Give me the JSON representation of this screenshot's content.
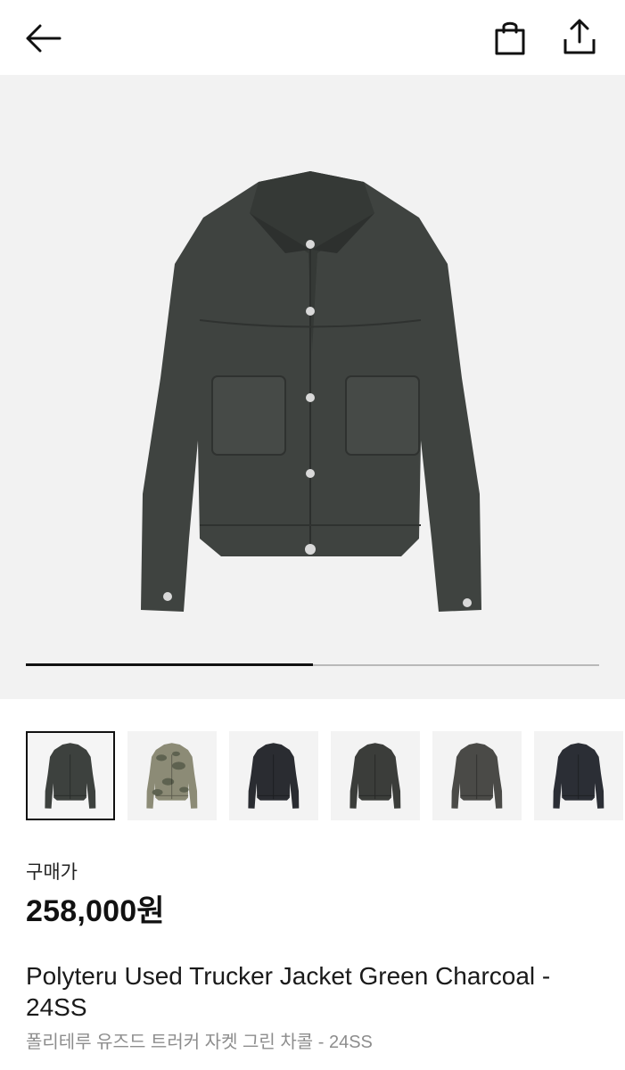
{
  "header": {
    "back_icon": "arrow-left-icon",
    "bag_icon": "shopping-bag-icon",
    "share_icon": "share-upload-icon"
  },
  "gallery": {
    "progress_fraction": 0.5,
    "main_jacket_color": "#3f4340",
    "thumbnails": [
      {
        "color": "#3d413e",
        "selected": true
      },
      {
        "color": "#8c8b76",
        "selected": false,
        "pattern": "camo"
      },
      {
        "color": "#2a2c31",
        "selected": false
      },
      {
        "color": "#3b3d3a",
        "selected": false
      },
      {
        "color": "#4a4a47",
        "selected": false
      },
      {
        "color": "#2b2e35",
        "selected": false
      }
    ]
  },
  "product": {
    "price_label": "구매가",
    "price": "258,000원",
    "title_en": "Polyteru Used Trucker Jacket Green Charcoal - 24SS",
    "title_ko": "폴리테루 유즈드 트러커 자켓 그린 차콜 - 24SS"
  }
}
